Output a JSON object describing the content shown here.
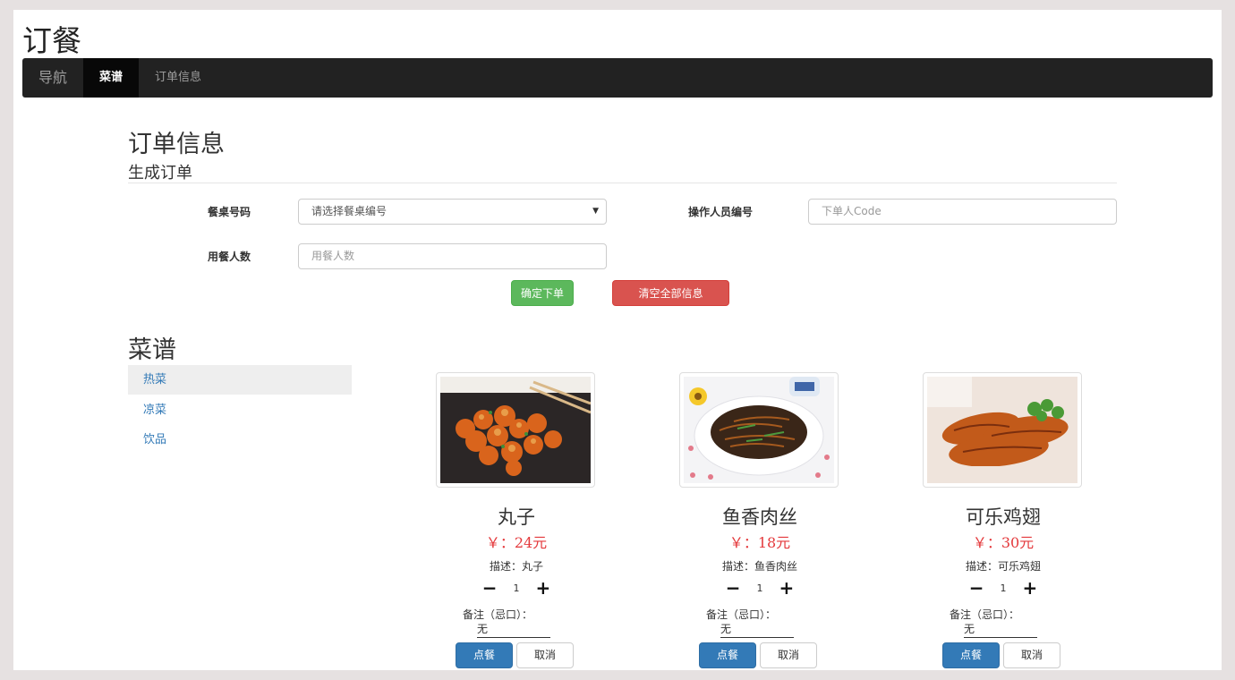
{
  "app": {
    "title": "订餐"
  },
  "nav": {
    "brand": "导航",
    "items": [
      {
        "label": "菜谱"
      },
      {
        "label": "订单信息"
      }
    ]
  },
  "order": {
    "heading": "订单信息",
    "subheading": "生成订单",
    "table_label": "餐桌号码",
    "table_select_value": "请选择餐桌编号",
    "operator_label": "操作人员编号",
    "operator_placeholder": "下单人Code",
    "diners_label": "用餐人数",
    "diners_placeholder": "用餐人数",
    "confirm_label": "确定下单",
    "clear_label": "清空全部信息"
  },
  "menu": {
    "heading": "菜谱",
    "categories": [
      {
        "label": "热菜"
      },
      {
        "label": "凉菜"
      },
      {
        "label": "饮品"
      }
    ],
    "dishes": [
      {
        "name": "丸子",
        "price": "￥：24元",
        "desc": "描述：丸子",
        "qty": "1",
        "note_label": "备注（忌口）：",
        "note_value": "无",
        "order_label": "点餐",
        "cancel_label": "取消"
      },
      {
        "name": "鱼香肉丝",
        "price": "￥：18元",
        "desc": "描述：鱼香肉丝",
        "qty": "1",
        "note_label": "备注（忌口）：",
        "note_value": "无",
        "order_label": "点餐",
        "cancel_label": "取消"
      },
      {
        "name": "可乐鸡翅",
        "price": "￥：30元",
        "desc": "描述：可乐鸡翅",
        "qty": "1",
        "note_label": "备注（忌口）：",
        "note_value": "无",
        "order_label": "点餐",
        "cancel_label": "取消"
      }
    ],
    "minus_symbol": "−",
    "plus_symbol": "+"
  },
  "colors": {
    "navbar": "#222222",
    "primary": "#337ab7",
    "success": "#5cb85c",
    "danger": "#d9534f",
    "price": "#e4393c"
  }
}
